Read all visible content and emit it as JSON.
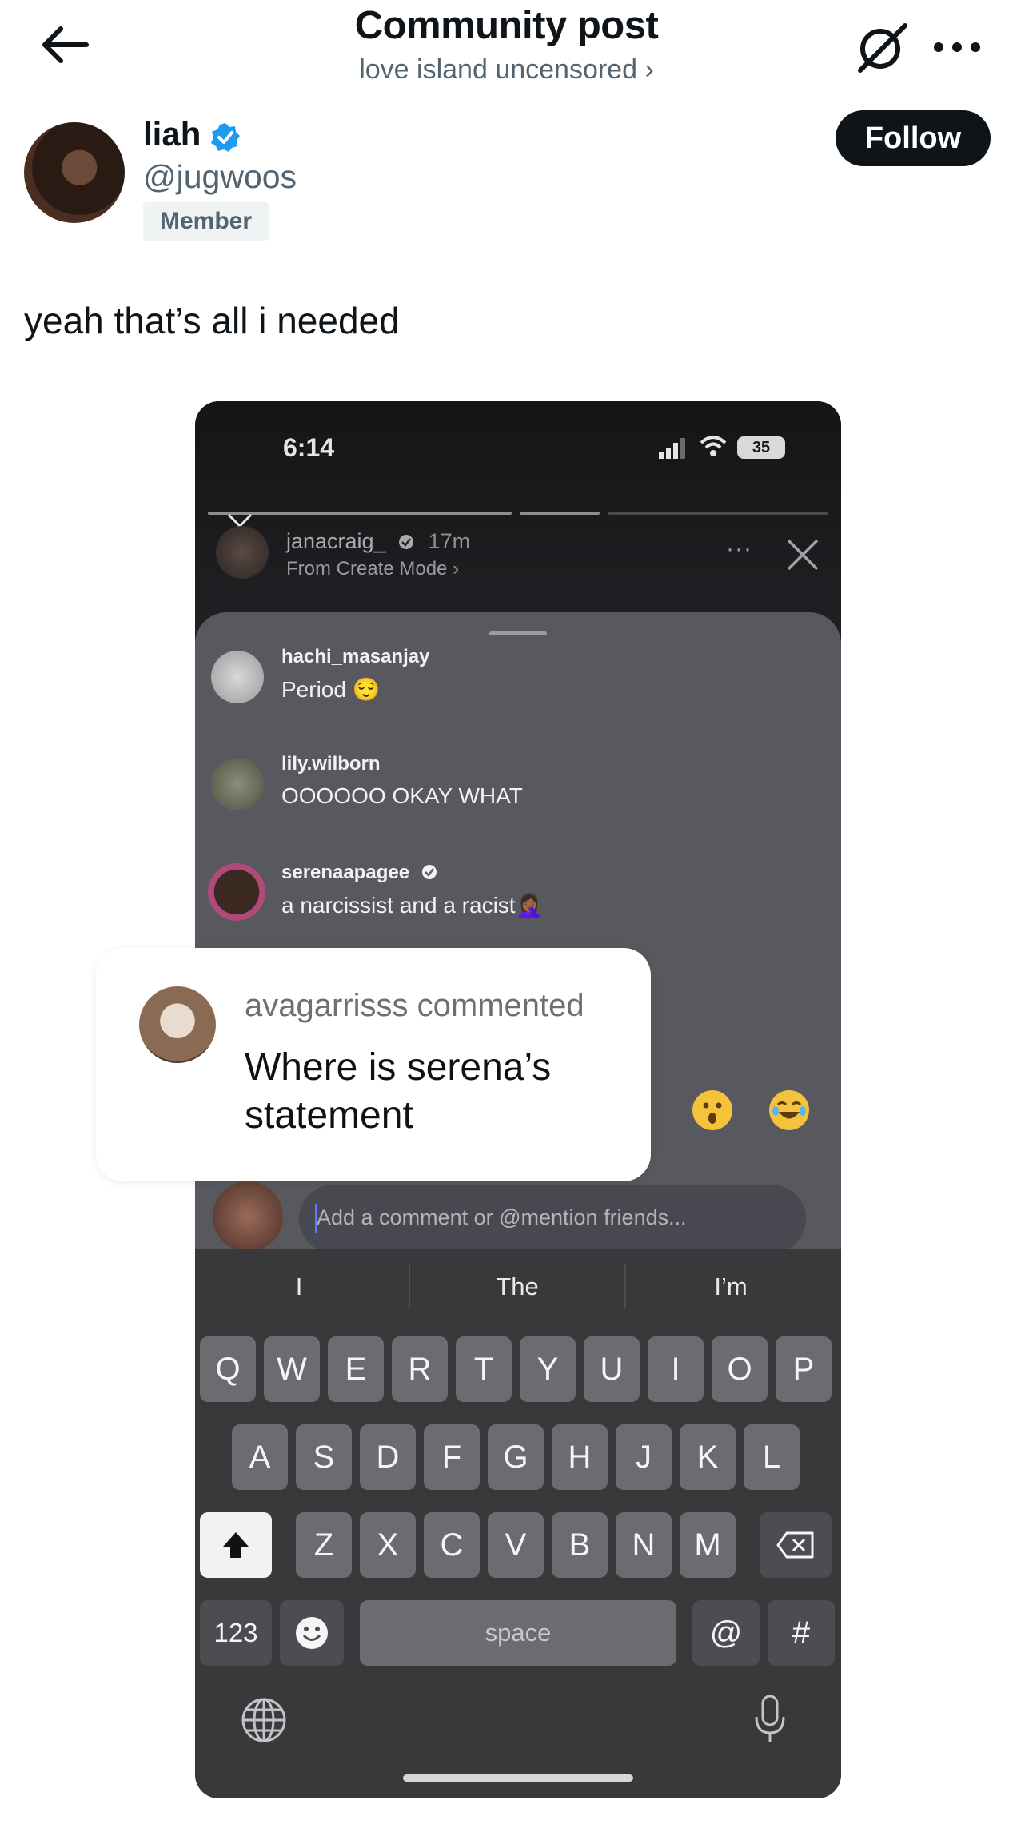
{
  "header": {
    "title": "Community post",
    "community": "love island uncensored ›"
  },
  "author": {
    "name": "liah",
    "handle": "@jugwoos",
    "badge": "Member",
    "follow_label": "Follow"
  },
  "post": {
    "text": "yeah that’s all i needed"
  },
  "screenshot": {
    "status_time": "6:14",
    "battery": "35",
    "story": {
      "username": "janacraig_",
      "age": "17m",
      "subtitle": "From Create Mode ›",
      "more": "···"
    },
    "comments": [
      {
        "user": "hachi_masanjay",
        "text": "Period 😌"
      },
      {
        "user": "lily.wilborn",
        "text": "OOOOOO OKAY WHAT"
      },
      {
        "user": "serenaapagee",
        "text": "a narcissist and a racist🤦🏾‍♀️"
      }
    ],
    "comment_placeholder": "Add a comment or @mention friends...",
    "keyboard": {
      "suggestions": [
        "I",
        "The",
        "I’m"
      ],
      "row1": [
        "Q",
        "W",
        "E",
        "R",
        "T",
        "Y",
        "U",
        "I",
        "O",
        "P"
      ],
      "row2": [
        "A",
        "S",
        "D",
        "F",
        "G",
        "H",
        "J",
        "K",
        "L"
      ],
      "row3": [
        "Z",
        "X",
        "C",
        "V",
        "B",
        "N",
        "M"
      ],
      "numbers": "123",
      "space": "space",
      "at": "@",
      "hash": "#"
    }
  },
  "overlay_comment": {
    "header": "avagarrisss commented",
    "text": "Where is serena’s statement"
  }
}
